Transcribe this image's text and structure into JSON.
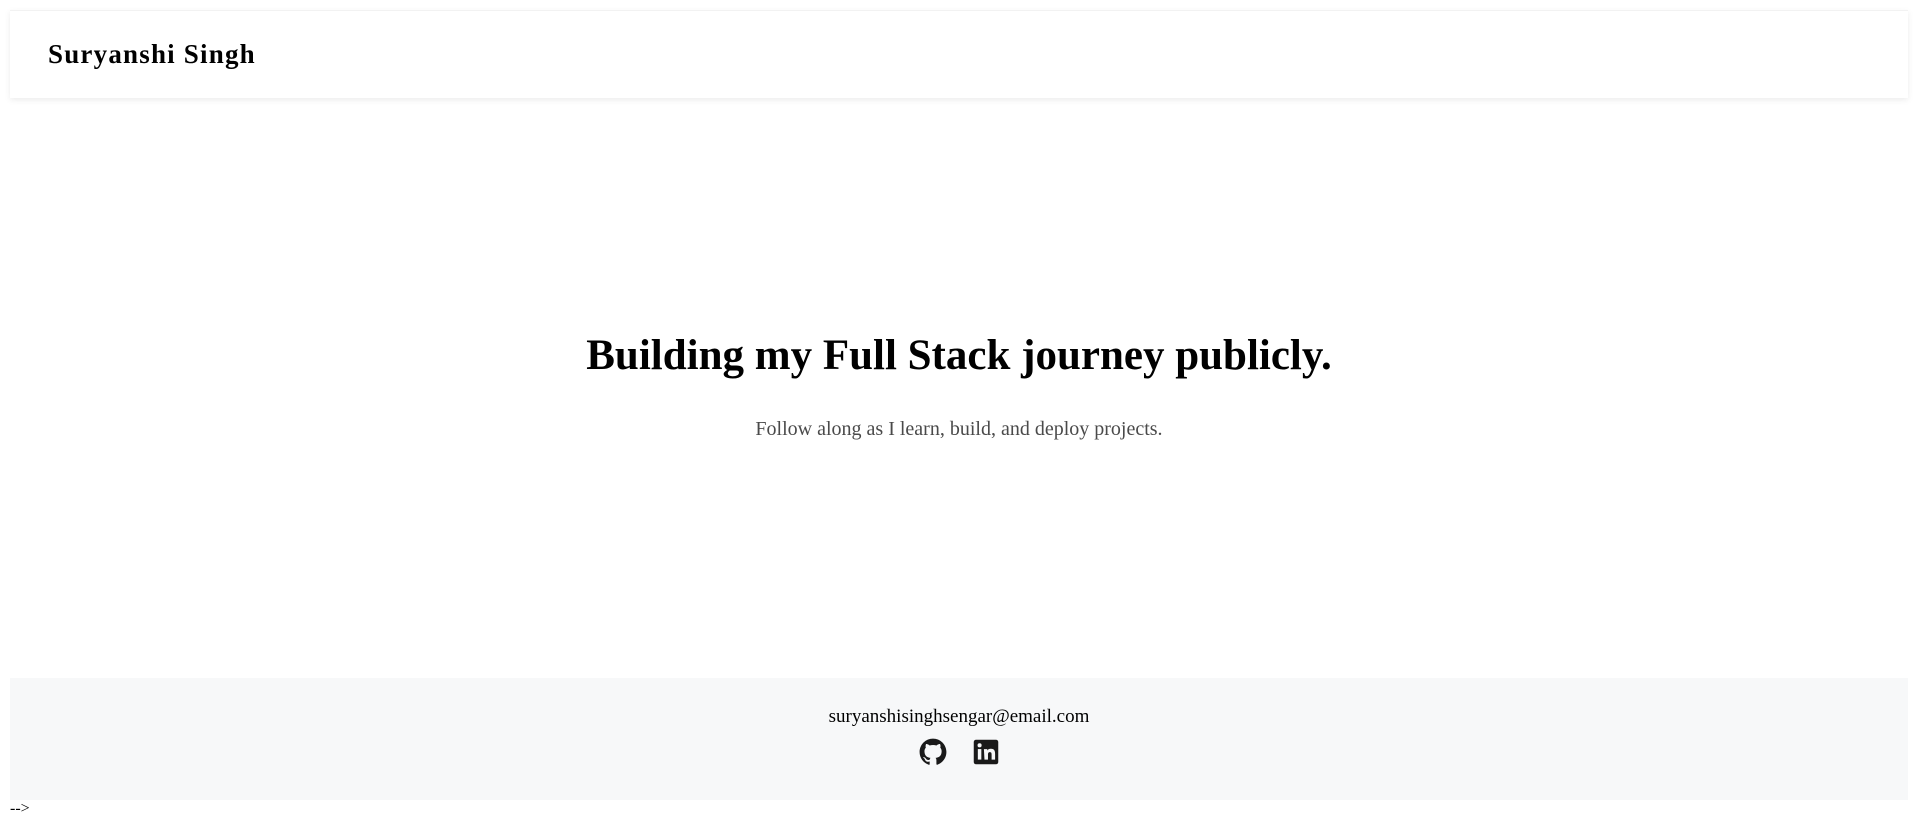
{
  "header": {
    "brand": "Suryanshi Singh"
  },
  "hero": {
    "title": "Building my Full Stack journey publicly.",
    "subtitle": "Follow along as I learn, build, and deploy projects."
  },
  "footer": {
    "email": "suryanshisinghsengar@email.com",
    "social": [
      {
        "icon": "github-icon"
      },
      {
        "icon": "linkedin-icon"
      }
    ]
  },
  "stray_text": "-->",
  "colors": {
    "footer_bg": "#f7f8f9",
    "subtitle": "#4a4a4a",
    "icon": "#1a1a1a"
  }
}
